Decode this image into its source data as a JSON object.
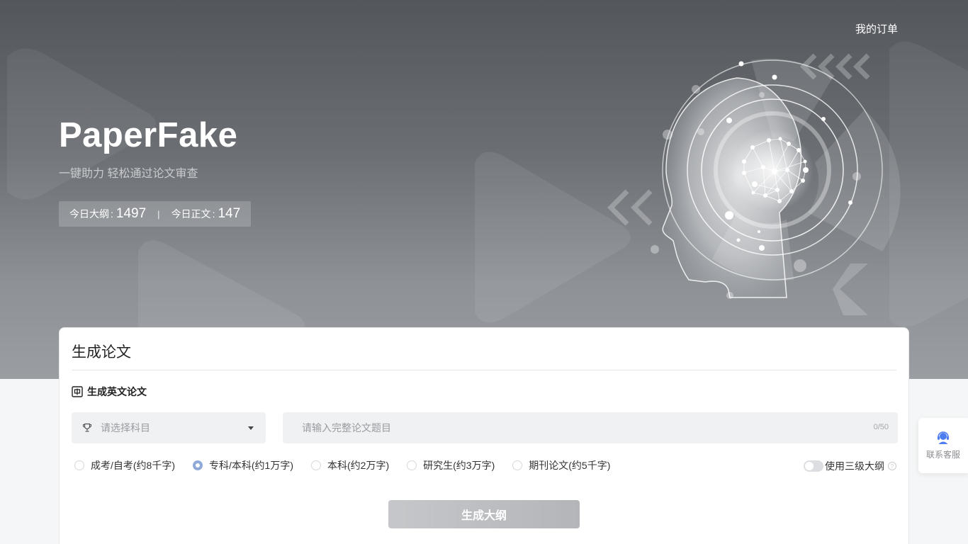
{
  "header": {
    "orders_link": "我的订单"
  },
  "hero": {
    "title": "PaperFake",
    "subtitle": "一键助力 轻松通过论文审查",
    "stats": {
      "outline_label": "今日大纲",
      "outline_count": "1497",
      "separator": "|",
      "body_label": "今日正文",
      "body_count": "147"
    }
  },
  "card": {
    "title": "生成论文",
    "english_toggle_label": "生成英文论文",
    "subject_select": {
      "placeholder": "请选择科目"
    },
    "title_input": {
      "placeholder": "请输入完整论文题目",
      "value": "",
      "counter": "0/50"
    },
    "levels": [
      {
        "label": "成考/自考(约8千字)",
        "selected": false
      },
      {
        "label": "专科/本科(约1万字)",
        "selected": true
      },
      {
        "label": "本科(约2万字)",
        "selected": false
      },
      {
        "label": "研究生(约3万字)",
        "selected": false
      },
      {
        "label": "期刊论文(约5千字)",
        "selected": false
      }
    ],
    "three_level_outline": {
      "label": "使用三级大纲",
      "enabled": false
    },
    "generate_button": "生成大纲"
  },
  "support": {
    "label": "联系客服"
  },
  "colors": {
    "hero_top": "#53575c",
    "hero_bottom": "#9a9ea3",
    "radio_selected": "#8fa9d8",
    "support_icon": "#4d7cf0",
    "button": "#bfc1c4"
  }
}
